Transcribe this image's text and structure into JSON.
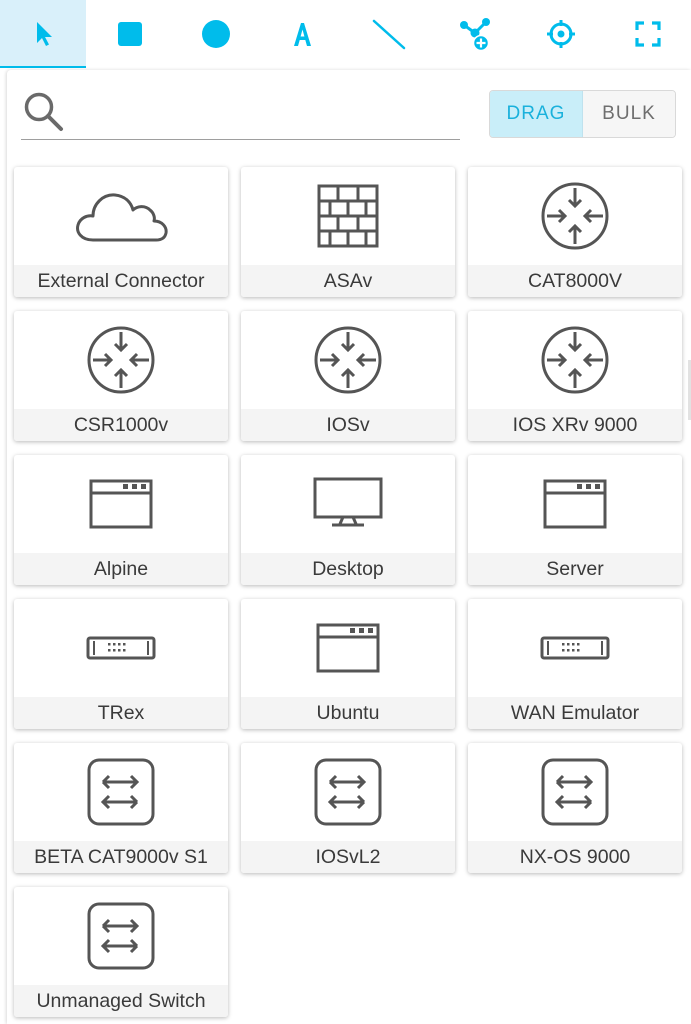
{
  "colors": {
    "accent": "#00bceb",
    "icon_stroke": "#555555"
  },
  "toolbar": {
    "tools": [
      {
        "name": "select-tool",
        "icon": "pointer-arrow-icon"
      },
      {
        "name": "rectangle-tool",
        "icon": "square-icon"
      },
      {
        "name": "ellipse-tool",
        "icon": "circle-icon"
      },
      {
        "name": "text-tool",
        "icon": "letter-a-icon"
      },
      {
        "name": "line-tool",
        "icon": "line-icon"
      },
      {
        "name": "add-node-tool",
        "icon": "node-add-icon"
      },
      {
        "name": "center-tool",
        "icon": "crosshair-icon"
      },
      {
        "name": "fit-tool",
        "icon": "fullscreen-icon"
      }
    ]
  },
  "palette": {
    "search": {
      "value": "",
      "placeholder": ""
    },
    "modes": {
      "drag": "DRAG",
      "bulk": "BULK",
      "active": "drag"
    },
    "nodes": [
      {
        "label": "External Connector",
        "icon": "cloud-icon"
      },
      {
        "label": "ASAv",
        "icon": "firewall-icon"
      },
      {
        "label": "CAT8000V",
        "icon": "router-icon"
      },
      {
        "label": "CSR1000v",
        "icon": "router-icon"
      },
      {
        "label": "IOSv",
        "icon": "router-icon"
      },
      {
        "label": "IOS XRv 9000",
        "icon": "router-icon"
      },
      {
        "label": "Alpine",
        "icon": "server-window-icon"
      },
      {
        "label": "Desktop",
        "icon": "monitor-icon"
      },
      {
        "label": "Server",
        "icon": "server-window-icon"
      },
      {
        "label": "TRex",
        "icon": "appliance-icon"
      },
      {
        "label": "Ubuntu",
        "icon": "server-window-icon"
      },
      {
        "label": "WAN Emulator",
        "icon": "appliance-icon"
      },
      {
        "label": "BETA CAT9000v S1",
        "icon": "switch-icon"
      },
      {
        "label": "IOSvL2",
        "icon": "switch-icon"
      },
      {
        "label": "NX-OS 9000",
        "icon": "switch-icon"
      },
      {
        "label": "Unmanaged Switch",
        "icon": "switch-icon"
      }
    ]
  }
}
